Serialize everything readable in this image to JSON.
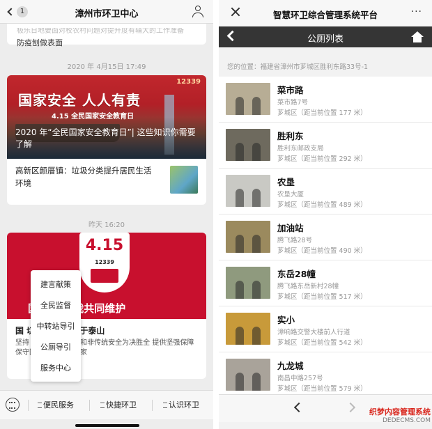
{
  "left": {
    "header": {
      "title": "漳州市环卫中心",
      "badge": "1"
    },
    "top_card": {
      "ghost_text": "极乐日地要面对校农村问题对提升度有辅大的工作准备",
      "line": "防疫刨做表面"
    },
    "timestamp1": "2020 年 4月15日 17:49",
    "news1": {
      "hotline": "12339",
      "banner_big": "国家安全  人人有责",
      "banner_small": "4.15 全民国家安全教育日",
      "caption": "2020 年“全民国家安全教育日”| 这些知识你需要了解",
      "sub_title": "高新区颜厝镇：垃圾分类提升居民生活环境"
    },
    "timestamp2": "昨天 16:20",
    "news2": {
      "shield_num": "4.15",
      "shield_hotline": "12339",
      "slogan": "国    需要你我共同维护",
      "title": "国    切 保密责任重于泰山",
      "body": "坚持    ，统筹传统安全和非传统安全为决胜全    提供坚强保障保守国家秘密 维护国家"
    },
    "popup": {
      "items": [
        "建言献策",
        "全民监督",
        "中转站导引",
        "公厕导引",
        "服务中心"
      ]
    },
    "bottom": {
      "menus": [
        "便民服务",
        "快捷环卫",
        "认识环卫"
      ]
    }
  },
  "right": {
    "header": {
      "title": "智慧环卫综合管理系统平台",
      "more": "···"
    },
    "nav": {
      "title": "公厕列表"
    },
    "location": {
      "label": "您的位置：",
      "value": "福建省漳州市芗城区胜利东路33号-1"
    },
    "toilets": [
      {
        "name": "菜市路",
        "address": "菜市路7号",
        "distance": "芗城区（距当前位置 177 米）",
        "color": "#b7ad95"
      },
      {
        "name": "胜利东",
        "address": "胜利东邮政支局",
        "distance": "芗城区（距当前位置 292 米）",
        "color": "#6e6a5e"
      },
      {
        "name": "农垦",
        "address": "农垦大厦",
        "distance": "芗城区（距当前位置 489 米）",
        "color": "#c9c9c4"
      },
      {
        "name": "加油站",
        "address": "腾飞路28号",
        "distance": "芗城区（距当前位置 490 米）",
        "color": "#9b8a5e"
      },
      {
        "name": "东岳28幢",
        "address": "腾飞路东岳新村28幢",
        "distance": "芗城区（距当前位置 517 米）",
        "color": "#8f9a7e"
      },
      {
        "name": "实小",
        "address": "漳响路交警大楼前人行道",
        "distance": "芗城区（距当前位置 542 米）",
        "color": "#c89a3a"
      },
      {
        "name": "九龙城",
        "address": "南昌中路257号",
        "distance": "芗城区（距当前位置 579 米）",
        "color": "#a9a39a"
      }
    ]
  },
  "watermark": {
    "line1": "织梦内容管理系统",
    "line2": "DEDECMS.COM"
  }
}
